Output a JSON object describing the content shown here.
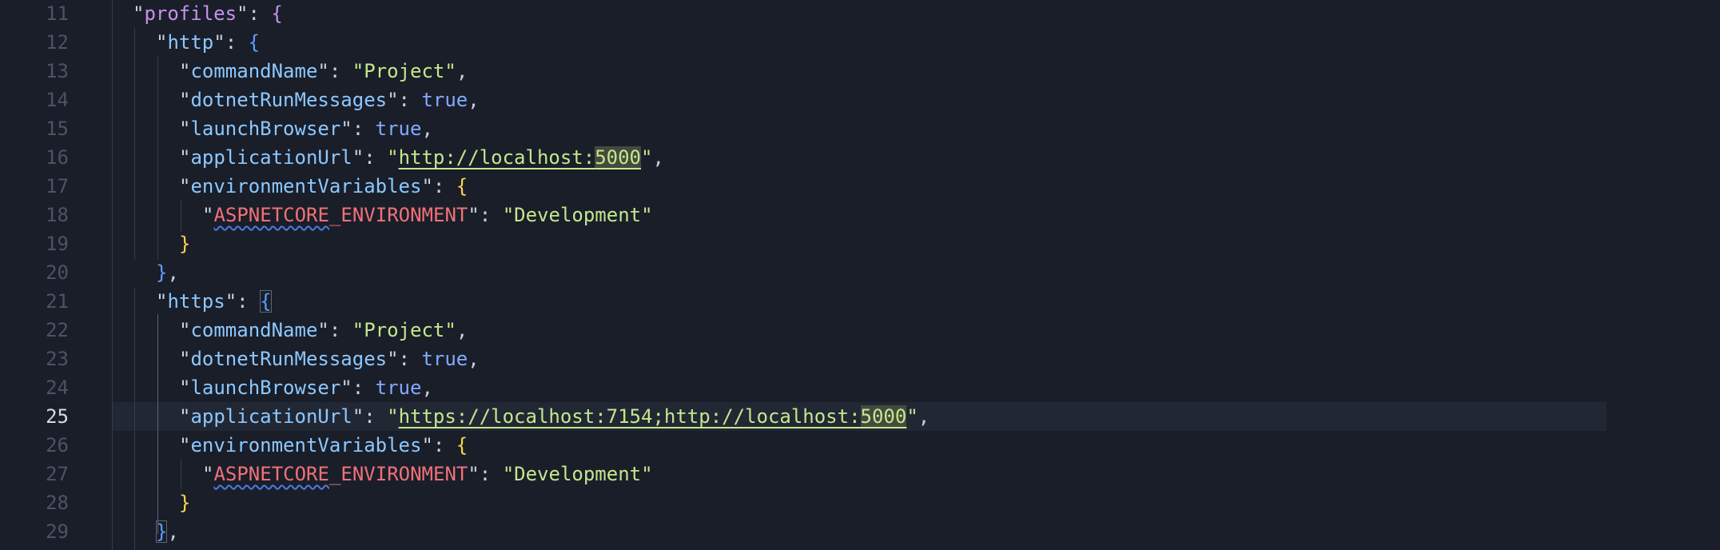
{
  "editor": {
    "current_line": 25,
    "lines": [
      {
        "n": "11",
        "t": [
          [
            "q",
            "\""
          ],
          [
            "kp",
            "profiles"
          ],
          [
            "q",
            "\""
          ],
          [
            "p",
            ": "
          ],
          [
            "br-p",
            "{"
          ]
        ]
      },
      {
        "n": "12",
        "t": [
          [
            "q",
            "\""
          ],
          [
            "k",
            "http"
          ],
          [
            "q",
            "\""
          ],
          [
            "p",
            ": "
          ],
          [
            "br-b",
            "{"
          ]
        ]
      },
      {
        "n": "13",
        "t": [
          [
            "q",
            "\""
          ],
          [
            "k",
            "commandName"
          ],
          [
            "q",
            "\""
          ],
          [
            "p",
            ": "
          ],
          [
            "s",
            "\"Project\""
          ],
          [
            "p",
            ","
          ]
        ]
      },
      {
        "n": "14",
        "t": [
          [
            "q",
            "\""
          ],
          [
            "k",
            "dotnetRunMessages"
          ],
          [
            "q",
            "\""
          ],
          [
            "p",
            ": "
          ],
          [
            "b",
            "true"
          ],
          [
            "p",
            ","
          ]
        ]
      },
      {
        "n": "15",
        "t": [
          [
            "q",
            "\""
          ],
          [
            "k",
            "launchBrowser"
          ],
          [
            "q",
            "\""
          ],
          [
            "p",
            ": "
          ],
          [
            "b",
            "true"
          ],
          [
            "p",
            ","
          ]
        ]
      },
      {
        "n": "16",
        "t": [
          [
            "q",
            "\""
          ],
          [
            "k",
            "applicationUrl"
          ],
          [
            "q",
            "\""
          ],
          [
            "p",
            ": "
          ],
          [
            "s",
            "\""
          ],
          [
            "s link",
            "http://localhost:"
          ],
          [
            "s link hl",
            "5000"
          ],
          [
            "s",
            "\""
          ],
          [
            "p",
            ","
          ]
        ]
      },
      {
        "n": "17",
        "t": [
          [
            "q",
            "\""
          ],
          [
            "k",
            "environmentVariables"
          ],
          [
            "q",
            "\""
          ],
          [
            "p",
            ": "
          ],
          [
            "br-y",
            "{"
          ]
        ]
      },
      {
        "n": "18",
        "t": [
          [
            "q",
            "\""
          ],
          [
            "kr squig",
            "ASPNETCORE"
          ],
          [
            "kr",
            "_ENVIRONMENT"
          ],
          [
            "q",
            "\""
          ],
          [
            "p",
            ": "
          ],
          [
            "s",
            "\"Development\""
          ]
        ]
      },
      {
        "n": "19",
        "t": [
          [
            "br-y",
            "}"
          ]
        ]
      },
      {
        "n": "20",
        "t": [
          [
            "br-b",
            "}"
          ],
          [
            "p",
            ","
          ]
        ]
      },
      {
        "n": "21",
        "t": [
          [
            "q",
            "\""
          ],
          [
            "k",
            "https"
          ],
          [
            "q",
            "\""
          ],
          [
            "p",
            ": "
          ],
          [
            "br-b bracket-box",
            "{"
          ]
        ]
      },
      {
        "n": "22",
        "t": [
          [
            "q",
            "\""
          ],
          [
            "k",
            "commandName"
          ],
          [
            "q",
            "\""
          ],
          [
            "p",
            ": "
          ],
          [
            "s",
            "\"Project\""
          ],
          [
            "p",
            ","
          ]
        ]
      },
      {
        "n": "23",
        "t": [
          [
            "q",
            "\""
          ],
          [
            "k",
            "dotnetRunMessages"
          ],
          [
            "q",
            "\""
          ],
          [
            "p",
            ": "
          ],
          [
            "b",
            "true"
          ],
          [
            "p",
            ","
          ]
        ]
      },
      {
        "n": "24",
        "t": [
          [
            "q",
            "\""
          ],
          [
            "k",
            "launchBrowser"
          ],
          [
            "q",
            "\""
          ],
          [
            "p",
            ": "
          ],
          [
            "b",
            "true"
          ],
          [
            "p",
            ","
          ]
        ]
      },
      {
        "n": "25",
        "t": [
          [
            "q",
            "\""
          ],
          [
            "k",
            "applicationUrl"
          ],
          [
            "q",
            "\""
          ],
          [
            "p",
            ": "
          ],
          [
            "s",
            "\""
          ],
          [
            "s link",
            "https://localhost:7154;http://localhost:"
          ],
          [
            "s link hl",
            "5000"
          ],
          [
            "s",
            "\""
          ],
          [
            "p",
            ","
          ]
        ]
      },
      {
        "n": "26",
        "t": [
          [
            "q",
            "\""
          ],
          [
            "k",
            "environmentVariables"
          ],
          [
            "q",
            "\""
          ],
          [
            "p",
            ": "
          ],
          [
            "br-y",
            "{"
          ]
        ]
      },
      {
        "n": "27",
        "t": [
          [
            "q",
            "\""
          ],
          [
            "kr squig",
            "ASPNETCORE"
          ],
          [
            "kr",
            "_ENVIRONMENT"
          ],
          [
            "q",
            "\""
          ],
          [
            "p",
            ": "
          ],
          [
            "s",
            "\"Development\""
          ]
        ]
      },
      {
        "n": "28",
        "t": [
          [
            "br-y",
            "}"
          ]
        ]
      },
      {
        "n": "29",
        "t": [
          [
            "br-b bracket-box",
            "}"
          ],
          [
            "p",
            ","
          ]
        ]
      }
    ]
  }
}
